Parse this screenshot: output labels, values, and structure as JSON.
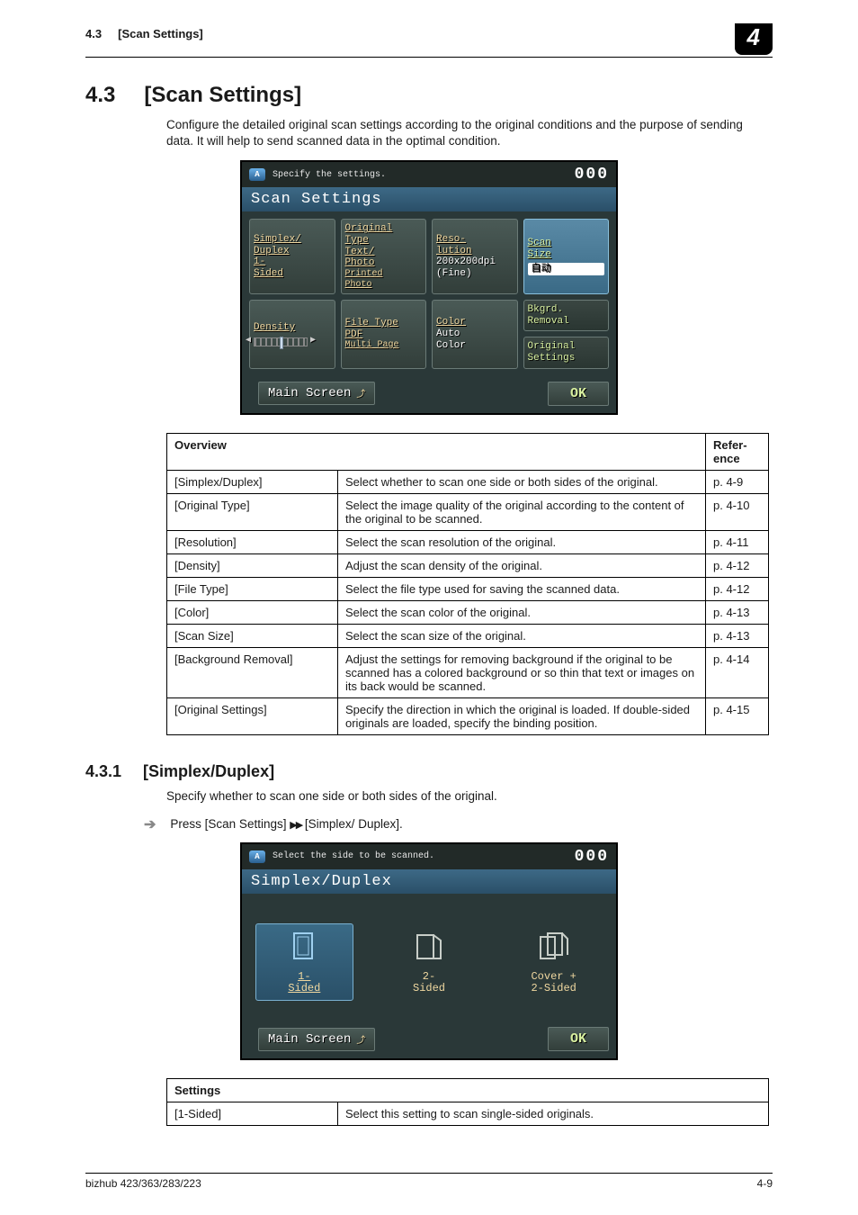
{
  "header": {
    "crumb_num": "4.3",
    "crumb_title": "[Scan Settings]",
    "chapter_badge": "4"
  },
  "sec43": {
    "num": "4.3",
    "title": "[Scan Settings]",
    "intro": "Configure the detailed original scan settings according to the original conditions and the purpose of sending data. It will help to send scanned data in the optimal condition."
  },
  "lcd1": {
    "status_icon": "A",
    "status_text": "Specify the settings.",
    "counter": "000",
    "title": "Scan Settings",
    "tiles": {
      "simplex": {
        "hdr": "Simplex/\nDuplex",
        "val": "1-\nSided"
      },
      "origtype": {
        "hdr": "Original\nType",
        "val": "Text/\nPhoto",
        "sub": "Printed\nPhoto"
      },
      "resolution": {
        "hdr": "Reso-\nlution",
        "val": "200x200dpi\n(Fine)"
      },
      "scansize": {
        "hdr": "Scan\nSize",
        "val": "自动"
      },
      "density": {
        "hdr": "Density"
      },
      "filetype": {
        "hdr": "File Type",
        "val": "PDF",
        "sub": "Multi Page"
      },
      "color": {
        "hdr": "Color",
        "val": "Auto\nColor"
      },
      "bkgrd": {
        "hdr": "Bkgrd.\nRemoval"
      },
      "origset": {
        "hdr": "Original\nSettings"
      }
    },
    "main_btn": "Main Screen",
    "ok_btn": "OK"
  },
  "table1": {
    "head_overview": "Overview",
    "head_ref": "Refer-ence",
    "rows": [
      {
        "o": "[Simplex/Duplex]",
        "d": "Select whether to scan one side or both sides of the original.",
        "r": "p. 4-9"
      },
      {
        "o": "[Original Type]",
        "d": "Select the image quality of the original according to the content of the original to be scanned.",
        "r": "p. 4-10"
      },
      {
        "o": "[Resolution]",
        "d": "Select the scan resolution of the original.",
        "r": "p. 4-11"
      },
      {
        "o": "[Density]",
        "d": "Adjust the scan density of the original.",
        "r": "p. 4-12"
      },
      {
        "o": "[File Type]",
        "d": "Select the file type used for saving the scanned data.",
        "r": "p. 4-12"
      },
      {
        "o": "[Color]",
        "d": "Select the scan color of the original.",
        "r": "p. 4-13"
      },
      {
        "o": "[Scan Size]",
        "d": "Select the scan size of the original.",
        "r": "p. 4-13"
      },
      {
        "o": "[Background Removal]",
        "d": "Adjust the settings for removing background if the original to be scanned has a colored background or so thin that text or images on its back would be scanned.",
        "r": "p. 4-14"
      },
      {
        "o": "[Original Settings]",
        "d": "Specify the direction in which the original is loaded. If double-sided originals are loaded, specify the binding position.",
        "r": "p. 4-15"
      }
    ]
  },
  "sec431": {
    "num": "4.3.1",
    "title": "[Simplex/Duplex]",
    "intro": "Specify whether to scan one side or both sides of the original.",
    "instr_pre": "Press [Scan Settings]",
    "instr_post": "[Simplex/ Duplex]."
  },
  "lcd2": {
    "status_icon": "A",
    "status_text": "Select the side to be scanned.",
    "counter": "000",
    "title": "Simplex/Duplex",
    "opts": {
      "one": "1-\nSided",
      "two": "2-\nSided",
      "cover": "Cover +\n2-Sided"
    },
    "main_btn": "Main Screen",
    "ok_btn": "OK"
  },
  "table2": {
    "head_settings": "Settings",
    "rows": [
      {
        "o": "[1-Sided]",
        "d": "Select this setting to scan single-sided originals."
      }
    ]
  },
  "footer": {
    "left": "bizhub 423/363/283/223",
    "right": "4-9"
  }
}
